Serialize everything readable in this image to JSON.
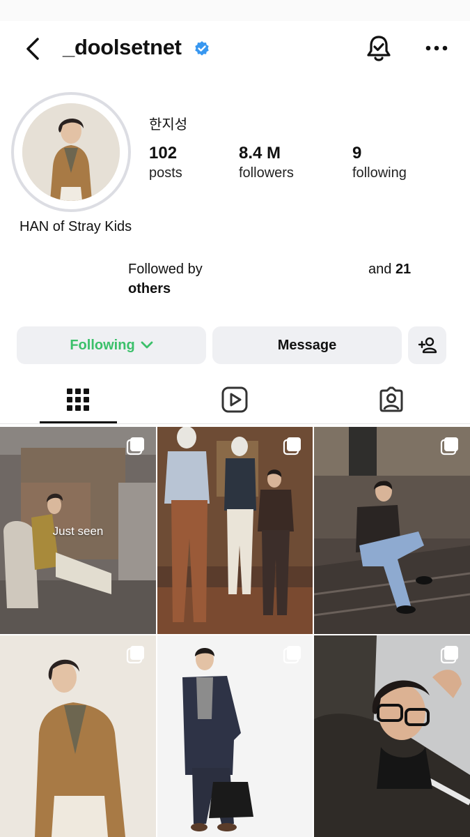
{
  "header": {
    "username": "_doolsetnet",
    "back_icon": "chevron-left-icon",
    "verified_icon": "verified-badge-icon",
    "notifications_icon": "bell-check-icon",
    "more_icon": "more-horizontal-icon",
    "verified_color": "#3897f0"
  },
  "profile": {
    "display_name": "한지성",
    "stats": {
      "posts": {
        "value": "102",
        "label": "posts"
      },
      "followers": {
        "value": "8.4 M",
        "label": "followers"
      },
      "following": {
        "value": "9",
        "label": "following"
      }
    },
    "bio": "HAN of Stray Kids",
    "followed_by": {
      "prefix": "Followed by",
      "others": "others",
      "and_text": "and",
      "count": "21"
    }
  },
  "actions": {
    "following_label": "Following",
    "following_color": "#3bc06a",
    "message_label": "Message",
    "add_user_icon": "add-person-icon"
  },
  "tabs": [
    {
      "name": "posts-grid",
      "icon": "grid-icon",
      "active": true
    },
    {
      "name": "reels",
      "icon": "reels-icon",
      "active": false
    },
    {
      "name": "tagged",
      "icon": "tagged-person-icon",
      "active": false
    }
  ],
  "grid": {
    "tiles": [
      {
        "overlay_text": "Just seen",
        "multi": true
      },
      {
        "multi": true
      },
      {
        "multi": true
      },
      {
        "multi": true
      },
      {
        "multi": true
      },
      {
        "multi": true
      }
    ]
  }
}
